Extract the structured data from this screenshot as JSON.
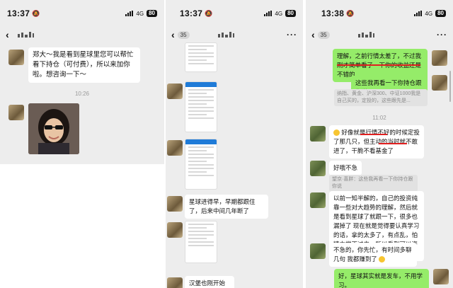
{
  "panel1": {
    "status": {
      "time": "13:37",
      "network": "4G",
      "battery": "80"
    },
    "msg1": "郑大～我是看到星球里您可以帮忙看下持仓（可付费），所以来加你啦。想咨询一下～",
    "time_divider": "10:26"
  },
  "panel2": {
    "status": {
      "time": "13:37",
      "network": "4G",
      "battery": "80"
    },
    "unread_count": "35",
    "msg1": "星球进得早，早期都跟住了，后来中间几年断了",
    "msg2": "汉堡也刚开始跟"
  },
  "panel3": {
    "status": {
      "time": "13:38",
      "network": "4G",
      "battery": "80"
    },
    "unread_count": "35",
    "msg1": "理解，之前行情太差了，不过我刚才简单看了一下你的收益还是不错的",
    "msg2": "这些我再看一下你持仓跟你说",
    "quote1": "纳指、黄金、沪深300、中证1000我是自己买的，定投的，这些跟先是...",
    "time_divider": "11:02",
    "msg3": "好像就是行情不好的时候定投了那几只，但主动的当时就不敢进了，干脆不看基金了",
    "msg4": "好哦不急",
    "quote2": "望京·喜胖：这些我再看一下你持仓跟你说",
    "msg5": "以前一知半解的，自己的投资纯靠一些对大趋势的理解，然后就是看到星球了就跟一下，很多也漏掉了 现在就是觉得要认真学习的话，拿的太多了，有点乱，怕精力学不过来，所以看到可以咨询马上就来了",
    "msg6": "不急的，你先忙，有时间多聊几句 我都赚到了",
    "msg7": "好，星球其实就是发车，不用学习。"
  },
  "colors": {
    "sent_bubble": "#95ec69",
    "received_bubble": "#ffffff",
    "chat_bg": "#ededed",
    "highlight": "#e02020"
  }
}
